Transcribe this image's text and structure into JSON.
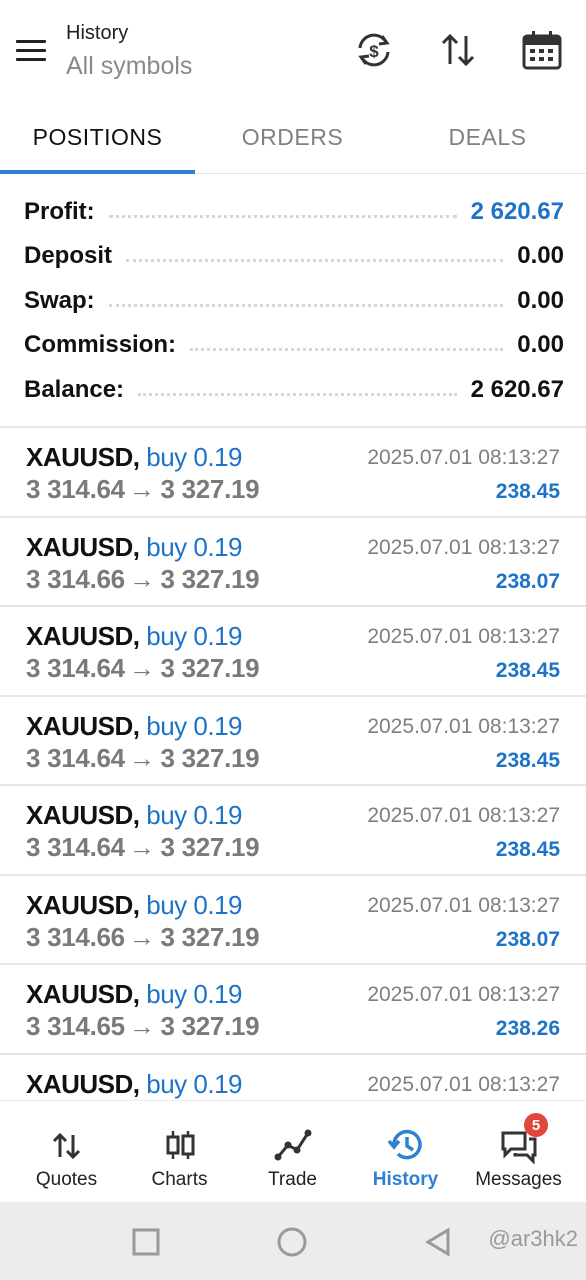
{
  "header": {
    "title": "History",
    "subtitle": "All symbols"
  },
  "tabs": [
    {
      "label": "POSITIONS",
      "active": true
    },
    {
      "label": "ORDERS",
      "active": false
    },
    {
      "label": "DEALS",
      "active": false
    }
  ],
  "summary": [
    {
      "label": "Profit:",
      "value": "2 620.67",
      "highlight": true
    },
    {
      "label": "Deposit",
      "value": "0.00",
      "highlight": false
    },
    {
      "label": "Swap:",
      "value": "0.00",
      "highlight": false
    },
    {
      "label": "Commission:",
      "value": "0.00",
      "highlight": false
    },
    {
      "label": "Balance:",
      "value": "2 620.67",
      "highlight": false
    }
  ],
  "positions": [
    {
      "symbol": "XAUUSD,",
      "side": "buy 0.19",
      "open": "3 314.64",
      "arrow": "→",
      "close": "3 327.19",
      "time": "2025.07.01 08:13:27",
      "profit": "238.45"
    },
    {
      "symbol": "XAUUSD,",
      "side": "buy 0.19",
      "open": "3 314.66",
      "arrow": "→",
      "close": "3 327.19",
      "time": "2025.07.01 08:13:27",
      "profit": "238.07"
    },
    {
      "symbol": "XAUUSD,",
      "side": "buy 0.19",
      "open": "3 314.64",
      "arrow": "→",
      "close": "3 327.19",
      "time": "2025.07.01 08:13:27",
      "profit": "238.45"
    },
    {
      "symbol": "XAUUSD,",
      "side": "buy 0.19",
      "open": "3 314.64",
      "arrow": "→",
      "close": "3 327.19",
      "time": "2025.07.01 08:13:27",
      "profit": "238.45"
    },
    {
      "symbol": "XAUUSD,",
      "side": "buy 0.19",
      "open": "3 314.64",
      "arrow": "→",
      "close": "3 327.19",
      "time": "2025.07.01 08:13:27",
      "profit": "238.45"
    },
    {
      "symbol": "XAUUSD,",
      "side": "buy 0.19",
      "open": "3 314.66",
      "arrow": "→",
      "close": "3 327.19",
      "time": "2025.07.01 08:13:27",
      "profit": "238.07"
    },
    {
      "symbol": "XAUUSD,",
      "side": "buy 0.19",
      "open": "3 314.65",
      "arrow": "→",
      "close": "3 327.19",
      "time": "2025.07.01 08:13:27",
      "profit": "238.26"
    },
    {
      "symbol": "XAUUSD,",
      "side": "buy 0.19",
      "open": "",
      "arrow": "",
      "close": "",
      "time": "2025.07.01 08:13:27",
      "profit": ""
    }
  ],
  "bottom_nav": [
    {
      "label": "Quotes",
      "icon": "quotes-icon",
      "active": false
    },
    {
      "label": "Charts",
      "icon": "charts-icon",
      "active": false
    },
    {
      "label": "Trade",
      "icon": "trade-icon",
      "active": false
    },
    {
      "label": "History",
      "icon": "history-icon",
      "active": true
    },
    {
      "label": "Messages",
      "icon": "messages-icon",
      "active": false,
      "badge": "5"
    }
  ],
  "system_bar": {
    "watermark": "@ar3hk2"
  },
  "colors": {
    "accent": "#2f80d1",
    "profit_blue": "#1e73c8",
    "badge_red": "#e0463a"
  }
}
